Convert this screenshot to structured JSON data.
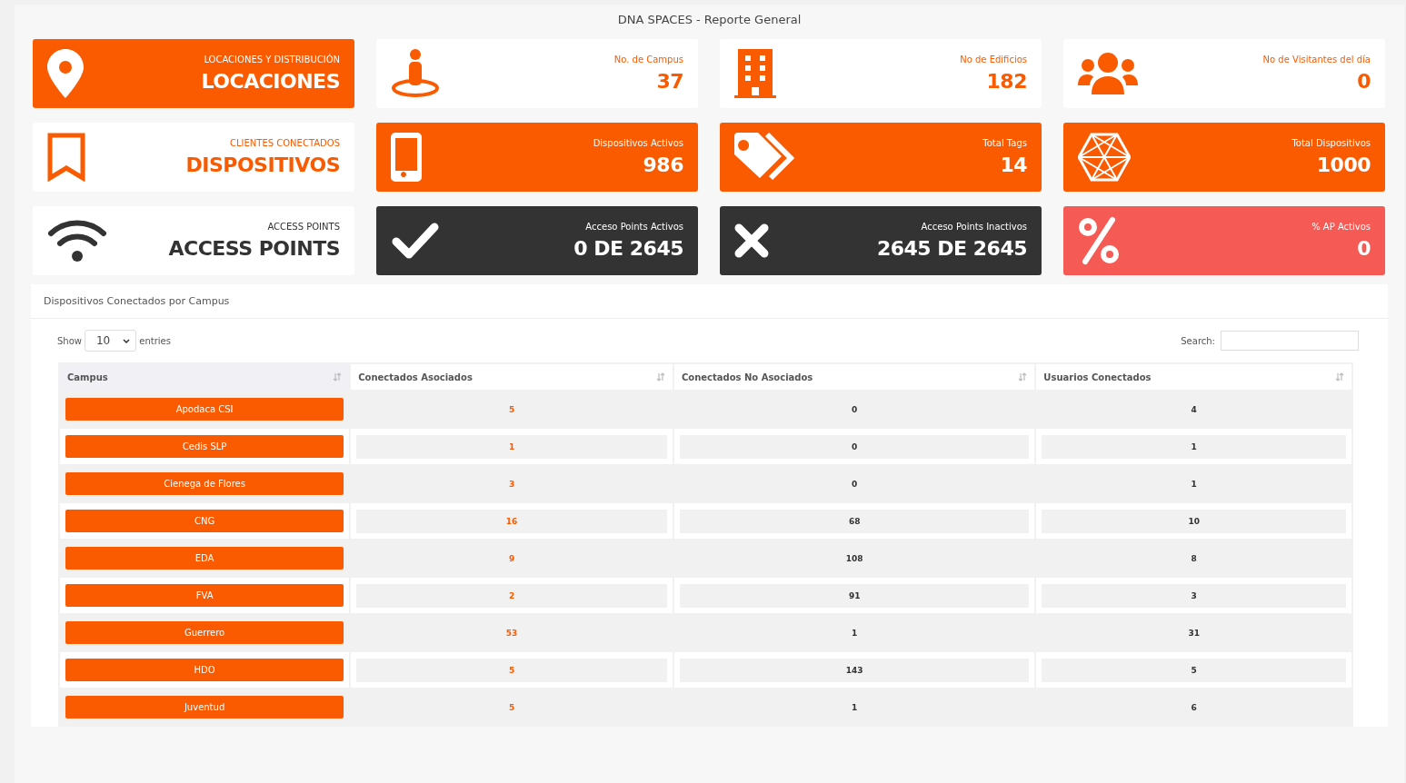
{
  "title": "DNA SPACES - Reporte General",
  "cards": [
    {
      "kind": "orange",
      "label": "LOCACIONES Y DISTRIBUCIÓN",
      "value": "LOCACIONES"
    },
    {
      "kind": "white",
      "label": "No. de Campus",
      "value": "37"
    },
    {
      "kind": "white",
      "label": "No de Edificios",
      "value": "182"
    },
    {
      "kind": "white",
      "label": "No de Visitantes del día",
      "value": "0"
    },
    {
      "kind": "white",
      "label": "CLIENTES CONECTADOS",
      "value": "DISPOSITIVOS"
    },
    {
      "kind": "orange",
      "label": "Dispositivos Activos",
      "value": "986"
    },
    {
      "kind": "orange",
      "label": "Total Tags",
      "value": "14"
    },
    {
      "kind": "orange",
      "label": "Total Dispositivos",
      "value": "1000"
    },
    {
      "kind": "plain",
      "label": "ACCESS POINTS",
      "value": "ACCESS POINTS"
    },
    {
      "kind": "dark",
      "label": "Acceso Points Activos",
      "value": "0 DE 2645"
    },
    {
      "kind": "dark",
      "label": "Acceso Points Inactivos",
      "value": "2645 DE 2645"
    },
    {
      "kind": "red",
      "label": "% AP Activos",
      "value": "0"
    }
  ],
  "panel": {
    "title": "Dispositivos Conectados por Campus",
    "show_label": "Show",
    "entries": "10",
    "entries_label": "entries",
    "search_label": "Search:",
    "columns": [
      "Campus",
      "Conectados Asociados",
      "Conectados No Asociados",
      "Usuarios Conectados"
    ],
    "rows": [
      {
        "campus": "Apodaca CSI",
        "asociados": "5",
        "no_asociados": "0",
        "usuarios": "4"
      },
      {
        "campus": "Cedis SLP",
        "asociados": "1",
        "no_asociados": "0",
        "usuarios": "1"
      },
      {
        "campus": "Cienega de Flores",
        "asociados": "3",
        "no_asociados": "0",
        "usuarios": "1"
      },
      {
        "campus": "CNG",
        "asociados": "16",
        "no_asociados": "68",
        "usuarios": "10"
      },
      {
        "campus": "EDA",
        "asociados": "9",
        "no_asociados": "108",
        "usuarios": "8"
      },
      {
        "campus": "FVA",
        "asociados": "2",
        "no_asociados": "91",
        "usuarios": "3"
      },
      {
        "campus": "Guerrero",
        "asociados": "53",
        "no_asociados": "1",
        "usuarios": "31"
      },
      {
        "campus": "HDO",
        "asociados": "5",
        "no_asociados": "143",
        "usuarios": "5"
      },
      {
        "campus": "Juventud",
        "asociados": "5",
        "no_asociados": "1",
        "usuarios": "6"
      }
    ]
  }
}
